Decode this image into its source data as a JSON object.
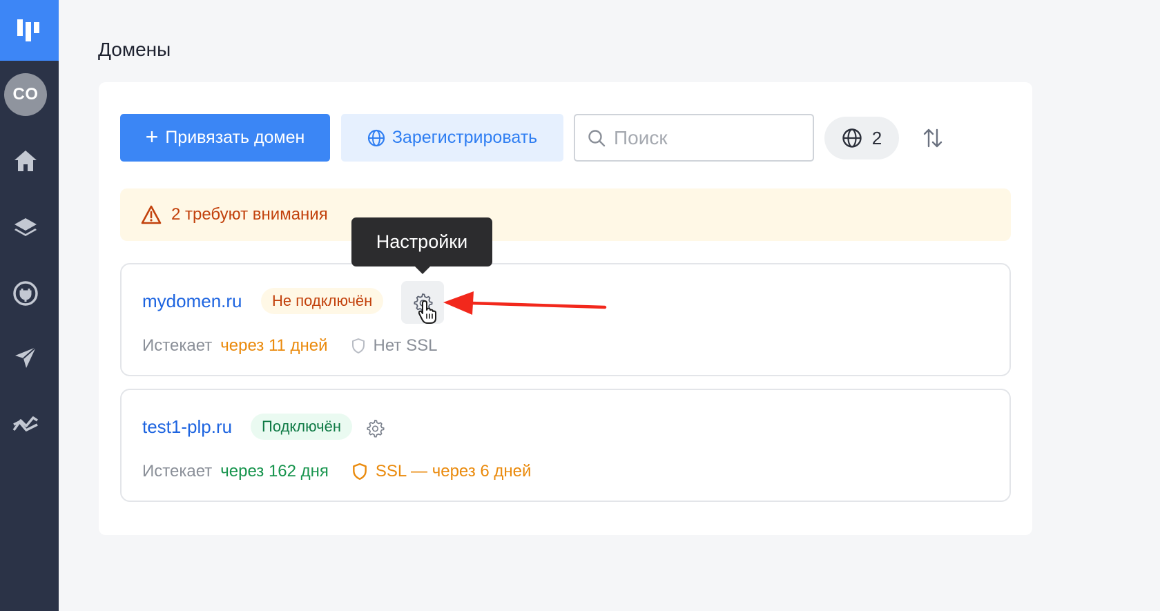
{
  "sidebar": {
    "avatar_initials": "CO",
    "logo_color": "#3d86f6",
    "background": "#2b3347",
    "icons": [
      "home-icon",
      "layers-icon",
      "plug-icon",
      "send-icon",
      "analytics-icon"
    ]
  },
  "page": {
    "title": "Домены"
  },
  "toolbar": {
    "attach_label": "Привязать домен",
    "register_label": "Зарегистрировать",
    "search_placeholder": "Поиск",
    "domain_count": "2"
  },
  "warning": {
    "text": "2 требуют внимания"
  },
  "tooltip": {
    "text": "Настройки"
  },
  "domains": [
    {
      "name": "mydomen.ru",
      "status": "Не подключён",
      "expires_label": "Истекает",
      "expires_value": "через 11 дней",
      "ssl_text": "Нет SSL"
    },
    {
      "name": "test1-plp.ru",
      "status": "Подключён",
      "expires_label": "Истекает",
      "expires_value": "через 162 дня",
      "ssl_text": "SSL — через 6 дней"
    }
  ],
  "colors": {
    "primary": "#3b86f5",
    "warning_text": "#c2410c",
    "success_text": "#0f7a45",
    "annotation_arrow": "#f2281c"
  }
}
